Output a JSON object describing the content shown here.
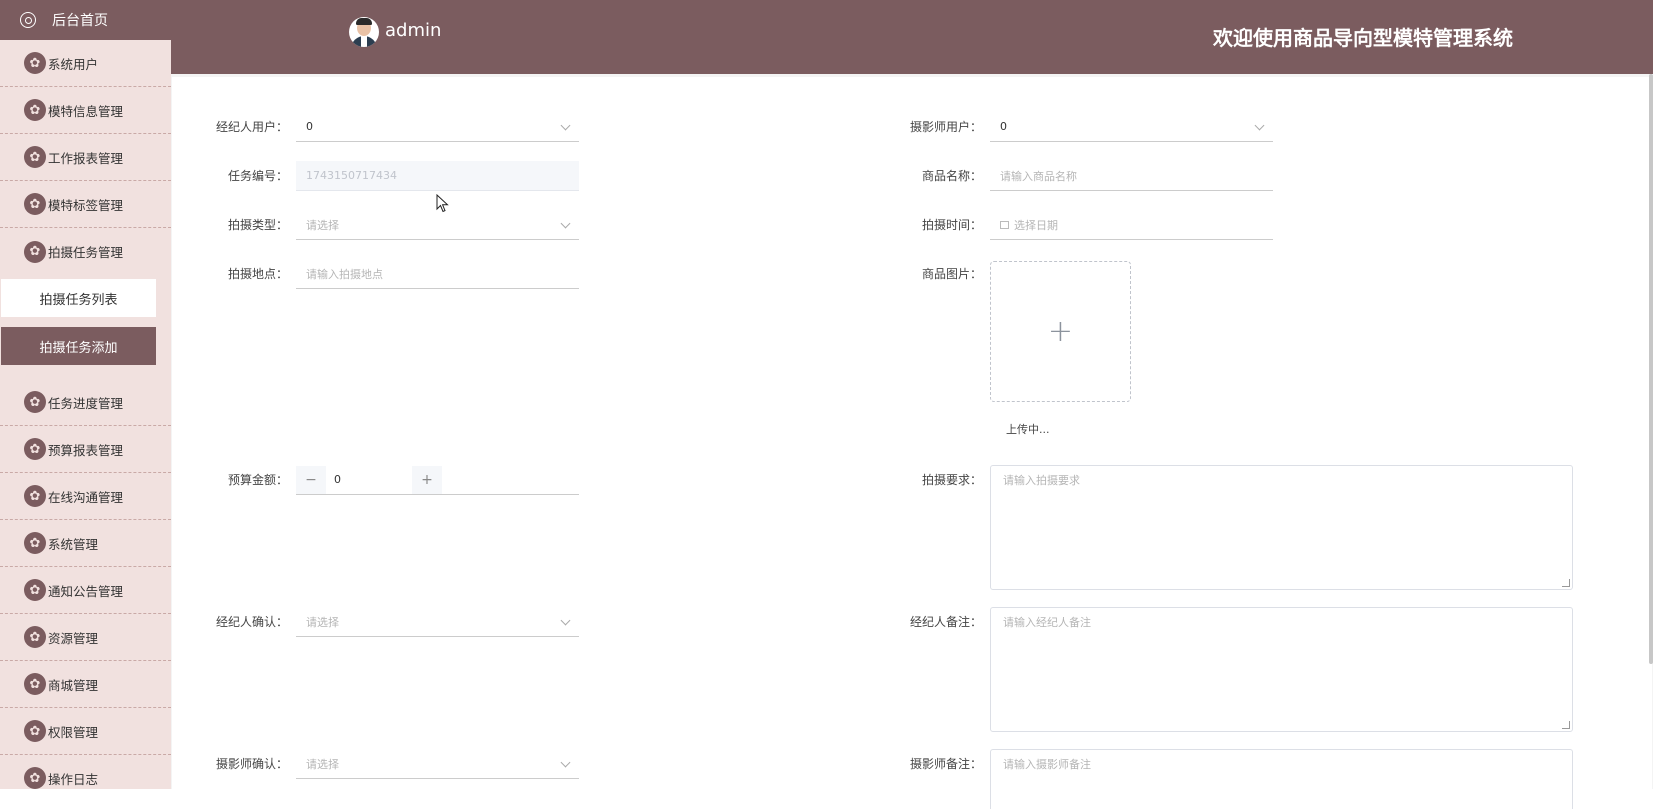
{
  "sidebar": {
    "home_label": "后台首页",
    "items_top": [
      "系统用户",
      "模特信息管理",
      "工作报表管理",
      "模特标签管理",
      "拍摄任务管理"
    ],
    "sub_items": [
      "拍摄任务列表",
      "拍摄任务添加"
    ],
    "items_bottom": [
      "任务进度管理",
      "预算报表管理",
      "在线沟通管理",
      "系统管理",
      "通知公告管理",
      "资源管理",
      "商城管理",
      "权限管理",
      "操作日志"
    ]
  },
  "header": {
    "user_name": "admin",
    "title": "欢迎使用商品导向型模特管理系统"
  },
  "form": {
    "agent_user": {
      "label": "经纪人用户：",
      "value": "0"
    },
    "photographer_user": {
      "label": "摄影师用户：",
      "value": "0"
    },
    "task_no": {
      "label": "任务编号：",
      "value": "1743150717434"
    },
    "product_name": {
      "label": "商品名称：",
      "placeholder": "请输入商品名称"
    },
    "shoot_type": {
      "label": "拍摄类型：",
      "placeholder": "请选择"
    },
    "shoot_time": {
      "label": "拍摄时间：",
      "placeholder": "选择日期"
    },
    "shoot_location": {
      "label": "拍摄地点：",
      "placeholder": "请输入拍摄地点"
    },
    "product_image": {
      "label": "商品图片：",
      "upload_status": "上传中..."
    },
    "budget": {
      "label": "预算金额：",
      "value": "0"
    },
    "shoot_requirement": {
      "label": "拍摄要求：",
      "placeholder": "请输入拍摄要求"
    },
    "agent_confirm": {
      "label": "经纪人确认：",
      "placeholder": "请选择"
    },
    "agent_note": {
      "label": "经纪人备注：",
      "placeholder": "请输入经纪人备注"
    },
    "photographer_confirm": {
      "label": "摄影师确认：",
      "placeholder": "请选择"
    },
    "photographer_note": {
      "label": "摄影师备注：",
      "placeholder": "请输入摄影师备注"
    }
  },
  "colors": {
    "accent": "#7b5c5f",
    "sidebar_bg": "#f1e1df"
  }
}
